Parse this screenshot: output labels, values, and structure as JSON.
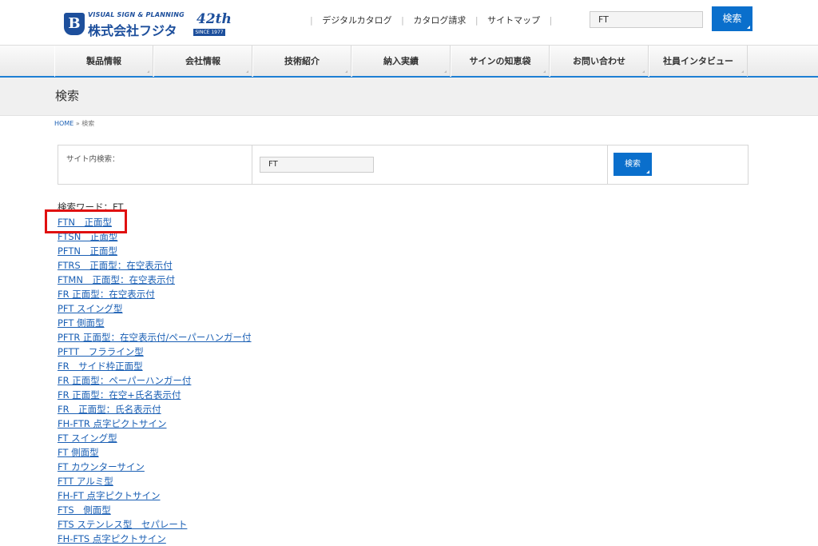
{
  "header": {
    "logo_mark": "B",
    "logo_en": "VISUAL SIGN & PLANNING",
    "logo_jp": "株式会社フジタ",
    "badge_num": "42th",
    "badge_since": "SINCE 1977",
    "links": [
      "デジタルカタログ",
      "カタログ請求",
      "サイトマップ"
    ],
    "search_value": "FT",
    "search_button": "検索"
  },
  "nav": {
    "items": [
      "製品情報",
      "会社情報",
      "技術紹介",
      "納入実績",
      "サインの知恵袋",
      "お問い合わせ",
      "社員インタビュー"
    ]
  },
  "page": {
    "title": "検索",
    "breadcrumb_home": "HOME",
    "breadcrumb_sep": "»",
    "breadcrumb_current": "検索"
  },
  "form": {
    "label": "サイト内検索：",
    "value": "FT",
    "button": "検索"
  },
  "results": {
    "heading": "検索ワード：FT",
    "items": [
      "FTN　正面型",
      "FTSN　正面型",
      "PFTN　正面型",
      "FTRS　正面型：在空表示付",
      "FTMN　正面型：在空表示付",
      "FR 正面型：在空表示付",
      "PFT スイング型",
      "PFT 側面型",
      "PFTR 正面型：在空表示付/ペーパーハンガー付",
      "PFTT　フラライン型",
      "FR　サイド枠正面型",
      "FR 正面型：ペーパーハンガー付",
      "FR 正面型：在空+氏名表示付",
      "FR　正面型：氏名表示付",
      "FH-FTR 点字ピクトサイン",
      "FT スイング型",
      "FT 側面型",
      "FT カウンターサイン",
      "FTT アルミ型",
      "FH-FT 点字ピクトサイン",
      "FTS　側面型",
      "FTS ステンレス型　セパレート",
      "FH-FTS 点字ピクトサイン"
    ]
  }
}
